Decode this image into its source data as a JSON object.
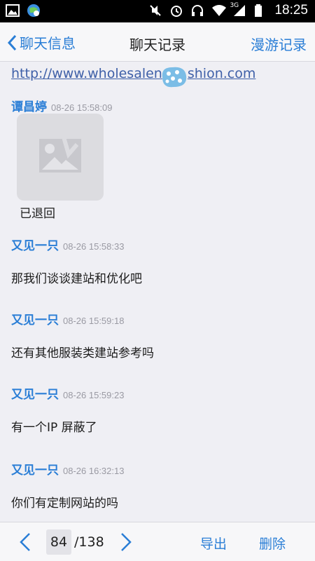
{
  "status_bar": {
    "time": "18:25",
    "network": "3G",
    "icons": [
      "image-icon",
      "browser-globe-icon",
      "mute-icon",
      "alarm-icon",
      "headset-icon",
      "wifi-icon",
      "signal-icon",
      "battery-icon"
    ]
  },
  "header": {
    "back_label": "聊天信息",
    "title": "聊天记录",
    "right_label": "漫游记录"
  },
  "content": {
    "link_text": "http://www.wholesalen",
    "link_text_tail": "shion.com",
    "messages": [
      {
        "sender": "谭昌婷",
        "time": "08-26 15:58:09",
        "status": "已退回"
      },
      {
        "sender": "又见一只",
        "time": "08-26 15:58:33",
        "text": "那我们谈谈建站和优化吧"
      },
      {
        "sender": "又见一只",
        "time": "08-26 15:59:18",
        "text": "还有其他服装类建站参考吗"
      },
      {
        "sender": "又见一只",
        "time": "08-26 15:59:23",
        "text": "有一个IP 屏蔽了"
      },
      {
        "sender": "又见一只",
        "time": "08-26 16:32:13",
        "text": "你们有定制网站的吗"
      }
    ]
  },
  "toolbar": {
    "current_page": "84",
    "total_pages": "/138",
    "export_label": "导出",
    "delete_label": "删除"
  },
  "colors": {
    "accent": "#2a7ed6",
    "background": "#efeff4",
    "timestamp": "#9a9aa3"
  }
}
